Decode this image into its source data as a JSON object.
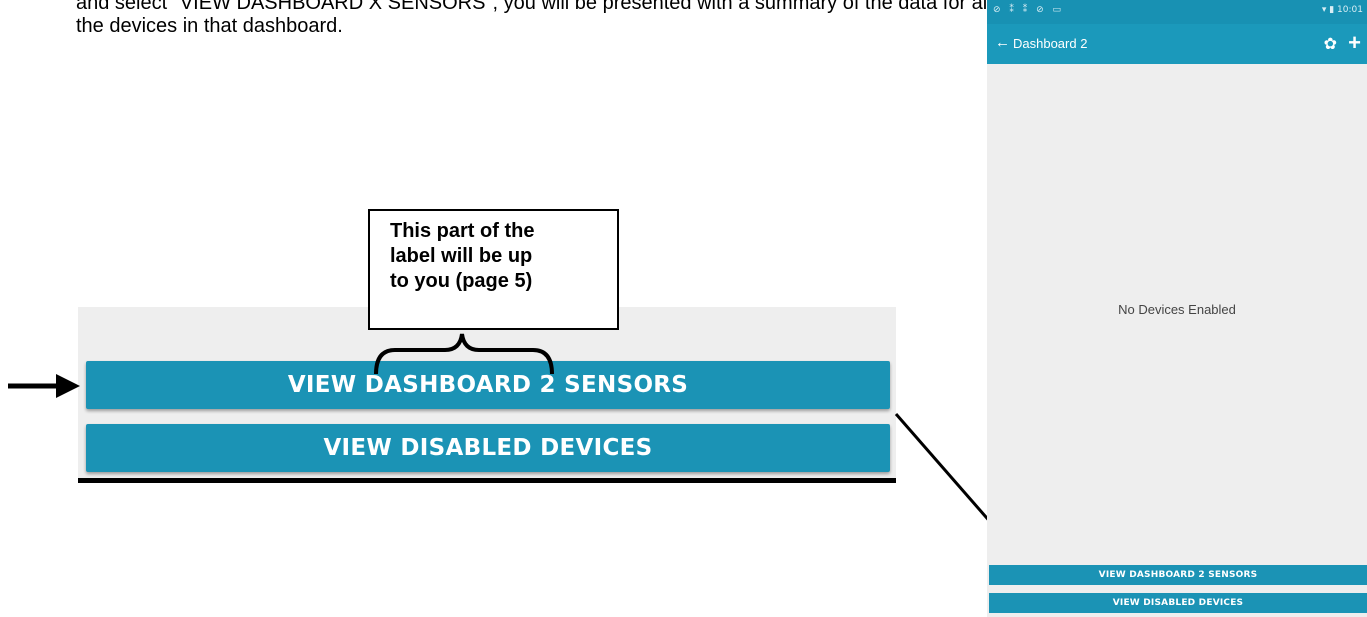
{
  "document": {
    "line_1": "and select \"VIEW DASHBOARD X SENSORS\",  you will be presented with a summary of the data for all sensors being m",
    "line_2": "the devices in that dashboard."
  },
  "callout": {
    "text_line_1": "This part of the",
    "text_line_2": "label will be up",
    "text_line_3": "to you (page 5)"
  },
  "zoom": {
    "sensors_button": "VIEW DASHBOARD 2 SENSORS",
    "disabled_button": "VIEW DISABLED DEVICES"
  },
  "phone": {
    "status_icons": "⊘ ⁑ ⁑ ⊘ ▭",
    "status_right": "▾ ▮ 10:01",
    "back_icon": "←",
    "title": "Dashboard 2",
    "settings_icon": "✿",
    "add_icon": "+",
    "empty_message": "No Devices Enabled",
    "sensors_button": "VIEW DASHBOARD 2 SENSORS",
    "disabled_button": "VIEW DISABLED DEVICES"
  },
  "colors": {
    "accent": "#1b93b5",
    "app_bar": "#1b99bb",
    "background": "#eeeeee"
  }
}
